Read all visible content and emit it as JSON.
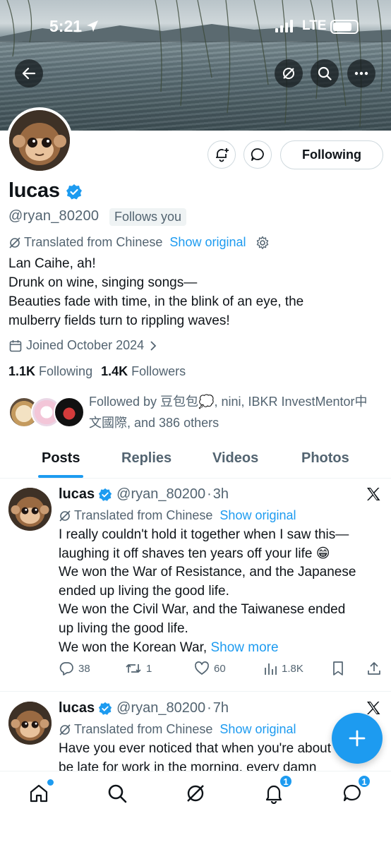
{
  "status_bar": {
    "time": "5:21",
    "network": "LTE"
  },
  "profile": {
    "name": "lucas",
    "handle": "@ryan_80200",
    "follows_you": "Follows you",
    "translated_label": "Translated from Chinese",
    "show_original": "Show original",
    "bio_lines": [
      "Lan Caihe, ah!",
      "Drunk on wine, singing songs—",
      "Beauties fade with time, in the blink of an eye, the",
      "mulberry fields turn to rippling waves!"
    ],
    "joined": "Joined October 2024",
    "following_count": "1.1K",
    "following_label": "Following",
    "followers_count": "1.4K",
    "followers_label": "Followers",
    "followed_by_line1": "Followed by 豆包包💭, nini, IBKR InvestMentor中",
    "followed_by_line2": "文國際, and 386 others",
    "following_button": "Following"
  },
  "tabs": [
    {
      "label": "Posts",
      "active": true
    },
    {
      "label": "Replies",
      "active": false
    },
    {
      "label": "Videos",
      "active": false
    },
    {
      "label": "Photos",
      "active": false
    }
  ],
  "posts": [
    {
      "name": "lucas",
      "handle": "@ryan_80200",
      "time": "3h",
      "translated_label": "Translated from Chinese",
      "show_original": "Show original",
      "body_lines": [
        "I really couldn't hold it together when I saw this—",
        "laughing it off shaves ten years off your life 😁",
        "We won the War of Resistance, and the Japanese",
        "ended up living the good life.",
        "We won the Civil War, and the Taiwanese ended",
        "up living the good life."
      ],
      "last_line": "We won the Korean War, ",
      "show_more": "Show more",
      "replies": "38",
      "reposts": "1",
      "likes": "60",
      "views": "1.8K"
    },
    {
      "name": "lucas",
      "handle": "@ryan_80200",
      "time": "7h",
      "translated_label": "Translated from Chinese",
      "show_original": "Show original",
      "body_lines": [
        "Have you ever noticed that when you're about to",
        "be late for work in the morning, every damn"
      ]
    }
  ],
  "bottom_nav": {
    "notifications_badge": "1",
    "messages_badge": "1"
  },
  "colors": {
    "accent": "#1d9bf0",
    "text": "#0f1419",
    "muted": "#536471"
  },
  "icons": [
    "back-arrow-icon",
    "grok-icon",
    "search-icon",
    "more-icon",
    "notify-add-icon",
    "message-icon",
    "verified-icon",
    "translate-icon",
    "gear-icon",
    "calendar-icon",
    "chevron-right-icon",
    "x-logo-icon",
    "reply-icon",
    "repost-icon",
    "like-icon",
    "views-icon",
    "bookmark-icon",
    "share-icon",
    "compose-plus-icon",
    "home-icon",
    "notifications-icon",
    "messages-icon"
  ]
}
